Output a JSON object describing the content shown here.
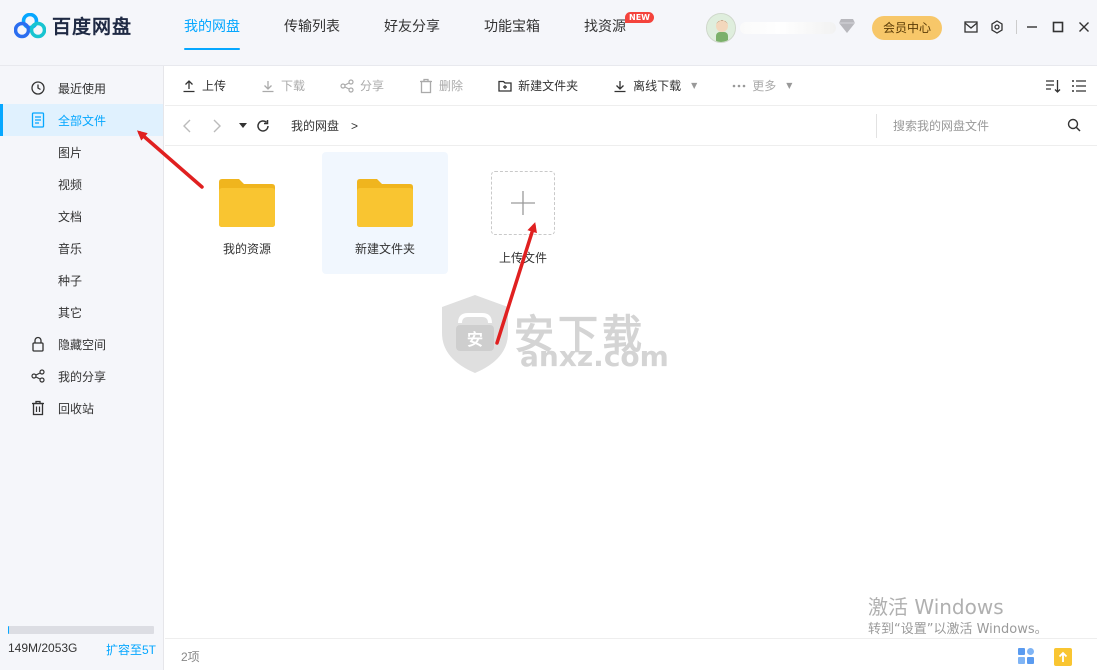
{
  "app": {
    "name": "百度网盘"
  },
  "nav": {
    "tabs": [
      {
        "label": "我的网盘",
        "active": true
      },
      {
        "label": "传输列表"
      },
      {
        "label": "好友分享"
      },
      {
        "label": "功能宝箱"
      },
      {
        "label": "找资源",
        "badge": "NEW"
      }
    ]
  },
  "header": {
    "vip_label": "会员中心"
  },
  "sidebar": {
    "items": [
      {
        "label": "最近使用",
        "icon": "clock-icon"
      },
      {
        "label": "全部文件",
        "icon": "document-icon",
        "active": true
      },
      {
        "label": "图片"
      },
      {
        "label": "视频"
      },
      {
        "label": "文档"
      },
      {
        "label": "音乐"
      },
      {
        "label": "种子"
      },
      {
        "label": "其它"
      },
      {
        "label": "隐藏空间",
        "icon": "lock-icon"
      },
      {
        "label": "我的分享",
        "icon": "share-icon"
      },
      {
        "label": "回收站",
        "icon": "trash-icon"
      }
    ],
    "storage": {
      "used": "149M/2053G",
      "expand": "扩容至5T",
      "fill_fraction": 0.01
    }
  },
  "toolbar": {
    "upload": "上传",
    "download": "下载",
    "share": "分享",
    "delete": "删除",
    "new_folder": "新建文件夹",
    "offline_download": "离线下载",
    "more": "更多"
  },
  "path": {
    "crumb": "我的网盘",
    "separator": ">",
    "search_placeholder": "搜索我的网盘文件"
  },
  "files": [
    {
      "name": "我的资源",
      "type": "folder"
    },
    {
      "name": "新建文件夹",
      "type": "folder"
    }
  ],
  "upload_tile": {
    "label": "上传文件"
  },
  "watermark": {
    "zh": "安下载",
    "en": "anxz.com"
  },
  "activation": {
    "title": "激活 Windows",
    "subtitle": "转到“设置”以激活 Windows。"
  },
  "status": {
    "count": "2项"
  },
  "colors": {
    "accent": "#06a7ff",
    "folder": "#f9c531",
    "annotation": "#e02020",
    "vip": "#f7c769"
  }
}
